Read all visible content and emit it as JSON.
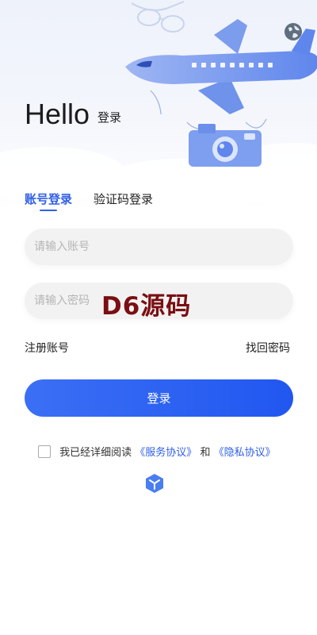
{
  "header": {
    "title": "Hello",
    "subtitle": "登录",
    "language_icon": "globe-icon"
  },
  "tabs": [
    {
      "label": "账号登录",
      "active": true
    },
    {
      "label": "验证码登录",
      "active": false
    }
  ],
  "form": {
    "account_placeholder": "请输入账号",
    "password_placeholder": "请输入密码",
    "register_label": "注册账号",
    "forgot_label": "找回密码",
    "login_label": "登录"
  },
  "agreement": {
    "prefix": "我已经详细阅读",
    "service_link": "《服务协议》",
    "joiner": "和",
    "privacy_link": "《隐私协议》",
    "checked": false
  },
  "watermark": "D6源码",
  "colors": {
    "accent": "#2f5fe6",
    "watermark": "#7a0e12",
    "input_bg": "#f2f2f2"
  }
}
